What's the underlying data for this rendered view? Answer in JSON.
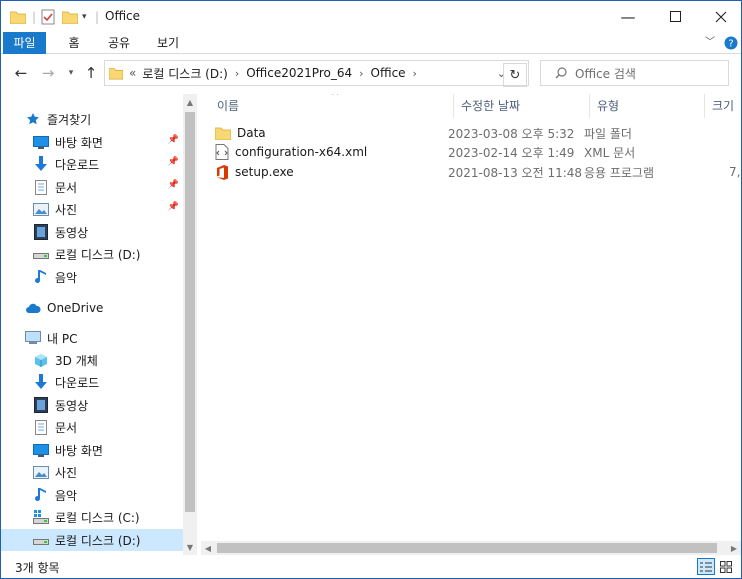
{
  "window": {
    "title": "Office"
  },
  "ribbon": {
    "tabs": [
      "파일",
      "홈",
      "공유",
      "보기"
    ]
  },
  "address": {
    "overflow": "«",
    "crumbs": [
      "로컬 디스크 (D:)",
      "Office2021Pro_64",
      "Office"
    ]
  },
  "search": {
    "placeholder": "Office 검색"
  },
  "nav": {
    "quick_access": "즐겨찾기",
    "quick_items": [
      "바탕 화면",
      "다운로드",
      "문서",
      "사진",
      "동영상",
      "로컬 디스크 (D:)",
      "음악"
    ],
    "onedrive": "OneDrive",
    "this_pc": "내 PC",
    "pc_items": [
      "3D 개체",
      "다운로드",
      "동영상",
      "문서",
      "바탕 화면",
      "사진",
      "음악",
      "로컬 디스크 (C:)",
      "로컬 디스크 (D:)"
    ]
  },
  "columns": {
    "name": "이름",
    "modified": "수정한 날짜",
    "type": "유형",
    "size": "크기"
  },
  "files": [
    {
      "name": "Data",
      "modified": "2023-03-08 오후 5:32",
      "type": "파일 폴더",
      "size": "",
      "icon": "folder-icon"
    },
    {
      "name": "configuration-x64.xml",
      "modified": "2023-02-14 오후 1:49",
      "type": "XML 문서",
      "size": "",
      "icon": "xml-file-icon"
    },
    {
      "name": "setup.exe",
      "modified": "2021-08-13 오전 11:48",
      "type": "응용 프로그램",
      "size": "7,",
      "icon": "office-setup-icon"
    }
  ],
  "status": {
    "count": "3개 항목"
  },
  "colors": {
    "accent": "#1979ca",
    "folder": "#f8d775",
    "selection": "#cce8ff",
    "office": "#d83b01"
  }
}
